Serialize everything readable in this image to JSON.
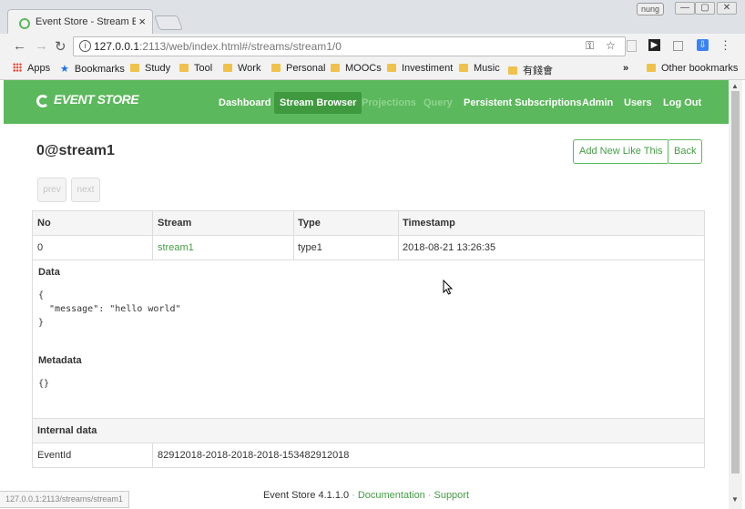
{
  "browser": {
    "tab_title": "Event Store - Stream Eve",
    "tab_close": "×",
    "user_badge": "nung",
    "win_min": "—",
    "win_max": "▢",
    "win_close": "✕",
    "url_host": "127.0.0.1",
    "url_rest": ":2113/web/index.html#/streams/stream1/0",
    "status_url": "127.0.0.1:2113/streams/stream1"
  },
  "bookmarks": {
    "items": [
      "Apps",
      "Bookmarks",
      "Study",
      "Tool",
      "Work",
      "Personal",
      "MOOCs",
      "Investiment",
      "Music",
      "有錢會"
    ],
    "overflow": "»",
    "other": "Other bookmarks"
  },
  "nav": {
    "logo": "EVENT STORE",
    "items": [
      "Dashboard",
      "Stream Browser",
      "Projections",
      "Query",
      "Persistent Subscriptions",
      "Admin",
      "Users",
      "Log Out"
    ]
  },
  "page": {
    "title": "0@stream1",
    "add_new_label": "Add New Like This",
    "back_label": "Back",
    "prev_label": "prev",
    "next_label": "next"
  },
  "table": {
    "headers": [
      "No",
      "Stream",
      "Type",
      "Timestamp"
    ],
    "row": {
      "no": "0",
      "stream": "stream1",
      "type": "type1",
      "timestamp": "2018-08-21 13:26:35"
    },
    "data_label": "Data",
    "data_json": "{\n  \"message\": \"hello world\"\n}",
    "metadata_label": "Metadata",
    "metadata_json": "{}",
    "internal_label": "Internal data",
    "event_id_label": "EventId",
    "event_id_value": "82912018-2018-2018-2018-153482912018"
  },
  "footer": {
    "version": "Event Store 4.1.1.0",
    "documentation": "Documentation",
    "support": "Support"
  }
}
